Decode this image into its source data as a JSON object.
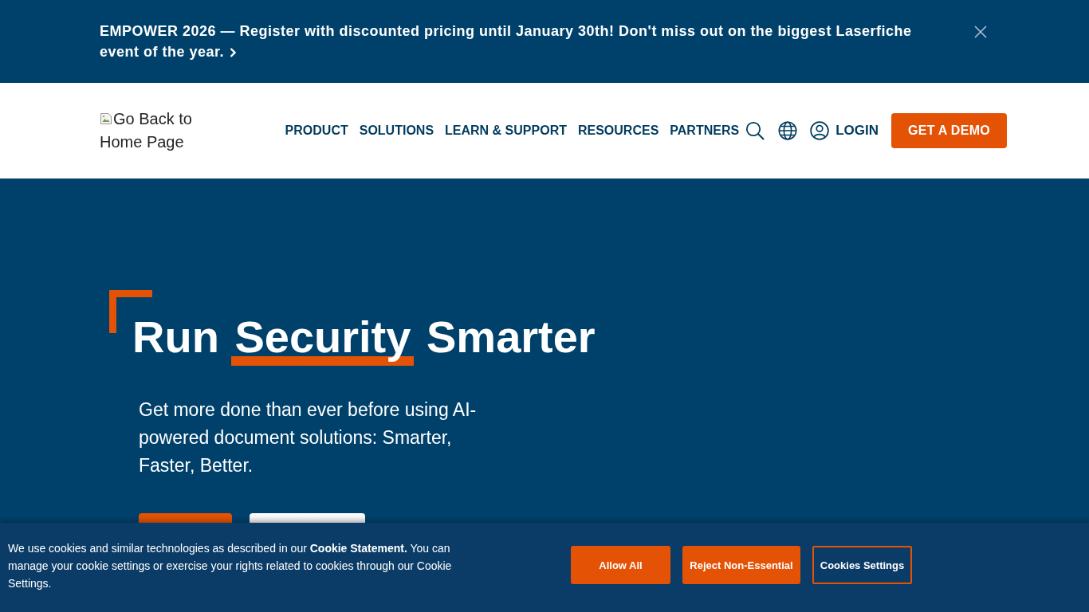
{
  "announcement": {
    "text": "EMPOWER 2026 — Register with discounted pricing until January 30th! Don't miss out on the biggest Laserfiche event of the year."
  },
  "header": {
    "logo_alt": "Go Back to Home Page",
    "nav": [
      "PRODUCT",
      "SOLUTIONS",
      "LEARN & SUPPORT",
      "RESOURCES",
      "PARTNERS"
    ],
    "login": "LOGIN",
    "cta": "GET A DEMO"
  },
  "hero": {
    "title": [
      {
        "text": "Run",
        "highlight": false
      },
      {
        "text": "Security",
        "highlight": true
      },
      {
        "text": "Smarter",
        "highlight": false
      }
    ],
    "subtitle": "Get more done than ever before using AI-powered document solutions: Smarter, Faster, Better.",
    "buttons": [
      {
        "kind": "primary"
      },
      {
        "kind": "secondary"
      }
    ]
  },
  "cookie_banner": {
    "text": "We use cookies and similar technologies as described in our **Cookie Statement.** You can manage your cookie settings or exercise your rights related to cookies through our Cookie Settings.",
    "buttons": [
      {
        "label": "Allow All",
        "kind": "filled"
      },
      {
        "label": "Reject Non-Essential",
        "kind": "filled"
      },
      {
        "label": "Cookies Settings",
        "kind": "outline"
      }
    ]
  }
}
